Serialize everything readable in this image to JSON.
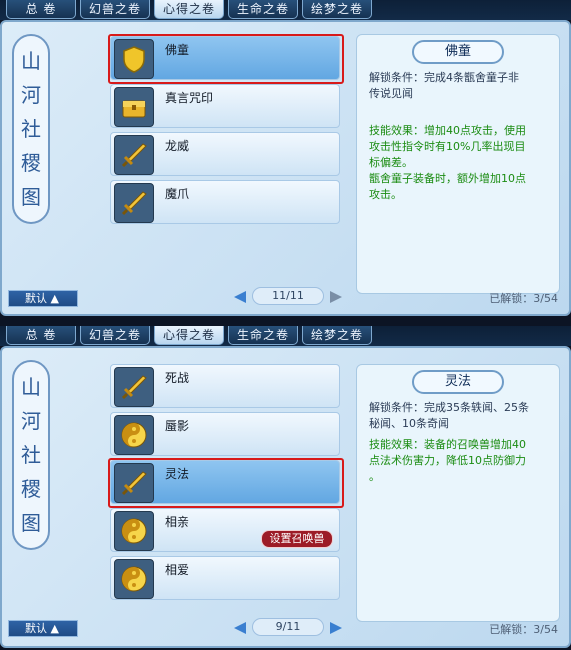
{
  "tabs": [
    "总 卷",
    "幻兽之卷",
    "心得之卷",
    "生命之卷",
    "绘梦之卷"
  ],
  "emblem": [
    "山",
    "河",
    "社",
    "稷",
    "图"
  ],
  "top": {
    "active_tab": 2,
    "skills": [
      {
        "name": "佛童",
        "icon": "shield-icon",
        "selected": true
      },
      {
        "name": "真言咒印",
        "icon": "treasure-chest-icon"
      },
      {
        "name": "龙威",
        "icon": "sword-icon"
      },
      {
        "name": "魔爪",
        "icon": "sword-icon"
      }
    ],
    "detail": {
      "title": "佛童",
      "unlock": "解锁条件：完成4条甑舍童子非\n传说见闻",
      "effect": "技能效果：增加40点攻击，使用\n攻击性指令时有10%几率出现目\n标偏差。\n甑舍童子装备时，额外增加10点\n攻击。"
    },
    "default": "默认 ▲",
    "page": "11/11",
    "unlocked": "已解锁：3/54"
  },
  "bottom": {
    "active_tab": 2,
    "skills": [
      {
        "name": "死战",
        "icon": "sword-icon"
      },
      {
        "name": "蜃影",
        "icon": "yin-yang-icon"
      },
      {
        "name": "灵法",
        "icon": "sword-icon",
        "selected": true
      },
      {
        "name": "相亲",
        "icon": "yin-yang-icon",
        "summon": true
      },
      {
        "name": "相爱",
        "icon": "yin-yang-icon"
      }
    ],
    "detail": {
      "title": "灵法",
      "unlock": "解锁条件：完成35条轶闻、25条\n秘闻、10条奇闻",
      "effect": "技能效果：装备的召唤兽增加40\n点法术伤害力，降低10点防御力\n。"
    },
    "summon_label": "设置召唤兽",
    "default": "默认 ▲",
    "page": "9/11",
    "unlocked": "已解锁：3/54"
  }
}
